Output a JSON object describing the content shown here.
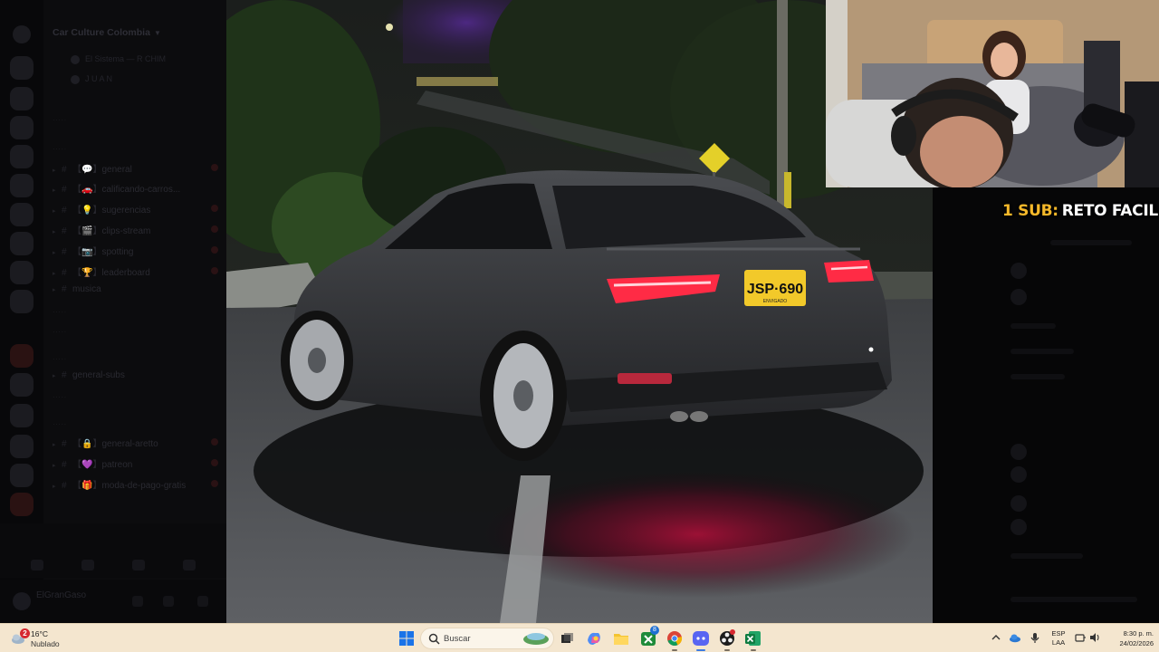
{
  "discord": {
    "server_name": "Car Culture Colombia",
    "voice_users": [
      "El Sistema — R CHIM",
      "J U A N"
    ],
    "channels": [
      {
        "label": "【💬】general"
      },
      {
        "label": "【🚗】calificando-carros..."
      },
      {
        "label": "【💡】sugerencias"
      },
      {
        "label": "【🎬】clips-stream"
      },
      {
        "label": "【📷】spotting"
      },
      {
        "label": "【🏆】leaderboard"
      },
      {
        "label": "musica"
      },
      {
        "label": "general-subs"
      },
      {
        "label": "【🔒】general-aretto"
      },
      {
        "label": "【💜】patreon"
      },
      {
        "label": "【🎁】moda-de-pago-gratis"
      }
    ],
    "user_name": "ElGranGaso"
  },
  "stream": {
    "plate_text": "JSP·690",
    "plate_sub": "ENVIGADO"
  },
  "sub_alert": {
    "prefix": "1 SUB:",
    "name": "RETO FACIL"
  },
  "taskbar": {
    "weather_temp": "16°C",
    "weather_desc": "Nublado",
    "weather_badge": "2",
    "search_placeholder": "Buscar",
    "lang_line1": "ESP",
    "lang_line2": "LAA",
    "time": "8:30 p. m.",
    "date": "24/02/2026",
    "apps": [
      "windows-start",
      "search",
      "widgets",
      "task-view",
      "copilot",
      "file-explorer",
      "xbox-app",
      "chrome",
      "discord",
      "obs",
      "excel"
    ],
    "xbox_badge": "8"
  },
  "colors": {
    "taskbar_bg": "#f4e6cf",
    "sub_prefix": "#f5b82a",
    "taillight": "#ff2b45",
    "plate": "#f2c92a"
  }
}
